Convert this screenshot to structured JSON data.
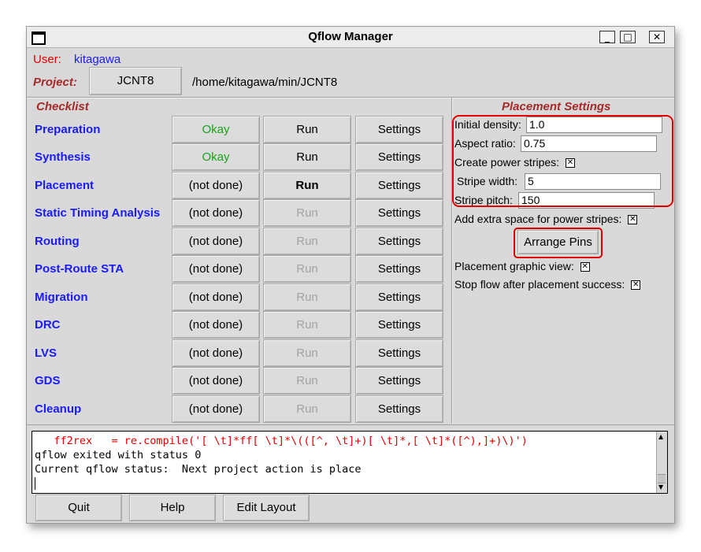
{
  "window": {
    "title": "Qflow Manager",
    "min_glyph": "_",
    "max_glyph": "□",
    "close_glyph": "✕"
  },
  "user": {
    "label": "User:",
    "name": "kitagawa"
  },
  "project": {
    "label": "Project:",
    "name": "JCNT8",
    "path": "/home/kitagawa/min/JCNT8"
  },
  "checklist": {
    "heading": "Checklist",
    "settings_label": "Settings",
    "steps": [
      {
        "name": "Preparation",
        "status": "Okay",
        "run": "Run"
      },
      {
        "name": "Synthesis",
        "status": "Okay",
        "run": "Run"
      },
      {
        "name": "Placement",
        "status": "(not done)",
        "run": "Run"
      },
      {
        "name": "Static Timing Analysis",
        "status": "(not done)",
        "run": "Run"
      },
      {
        "name": "Routing",
        "status": "(not done)",
        "run": "Run"
      },
      {
        "name": "Post-Route STA",
        "status": "(not done)",
        "run": "Run"
      },
      {
        "name": "Migration",
        "status": "(not done)",
        "run": "Run"
      },
      {
        "name": "DRC",
        "status": "(not done)",
        "run": "Run"
      },
      {
        "name": "LVS",
        "status": "(not done)",
        "run": "Run"
      },
      {
        "name": "GDS",
        "status": "(not done)",
        "run": "Run"
      },
      {
        "name": "Cleanup",
        "status": "(not done)",
        "run": "Run"
      }
    ]
  },
  "placement_settings": {
    "heading": "Placement Settings",
    "initial_density": {
      "label": "Initial density:",
      "value": "1.0"
    },
    "aspect_ratio": {
      "label": "Aspect ratio:",
      "value": "0.75"
    },
    "create_power_stripes": {
      "label": "Create power stripes:",
      "checked": true
    },
    "stripe_width": {
      "label": "Stripe width:",
      "value": "5"
    },
    "stripe_pitch": {
      "label": "Stripe pitch:",
      "value": "150"
    },
    "extra_space": {
      "label": "Add extra space for power stripes:",
      "checked": true
    },
    "arrange_pins": "Arrange Pins",
    "graphic_view": {
      "label": "Placement graphic view:",
      "checked": true
    },
    "stop_flow": {
      "label": "Stop flow after placement success:",
      "checked": true
    },
    "check_glyph": "✕"
  },
  "console": {
    "lines": [
      "   ff2rex   = re.compile('[ \\t]*ff[ \\t]*\\(([^, \\t]+)[ \\t]*,[ \\t]*([^),]+)\\)')",
      "qflow exited with status 0",
      "Current qflow status:  Next project action is place"
    ]
  },
  "bottom_buttons": {
    "quit": "Quit",
    "help": "Help",
    "edit_layout": "Edit Layout"
  },
  "colors": {
    "blue_link": "#1a1aff",
    "okay_green": "#1aa31a",
    "heading_red": "#a52a2a",
    "highlight_red": "#e00000"
  }
}
